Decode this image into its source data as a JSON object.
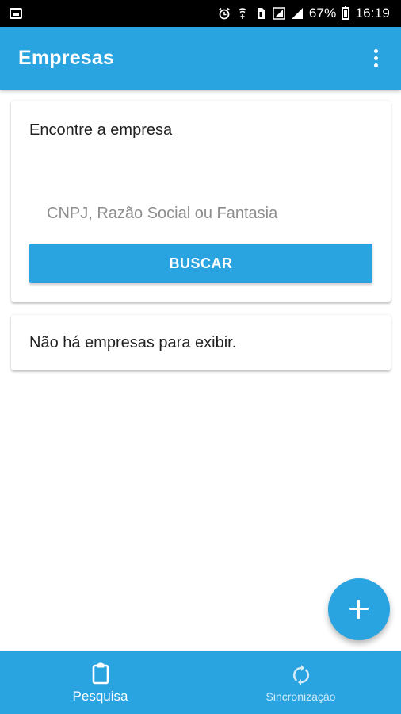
{
  "status_bar": {
    "battery_percent": "67%",
    "time": "16:19"
  },
  "app_bar": {
    "title": "Empresas"
  },
  "search_card": {
    "heading": "Encontre a empresa",
    "input_placeholder": "CNPJ, Razão Social ou Fantasia",
    "input_value": "",
    "button_label": "BUSCAR"
  },
  "results_card": {
    "empty_message": "Não há empresas para exibir."
  },
  "bottom_nav": {
    "items": [
      {
        "label": "Pesquisa",
        "icon": "clipboard-icon",
        "active": true
      },
      {
        "label": "Sincronização",
        "icon": "sync-icon",
        "active": false
      }
    ]
  },
  "colors": {
    "primary": "#2aa4e0",
    "status_bar": "#000000",
    "background": "#ffffff"
  }
}
